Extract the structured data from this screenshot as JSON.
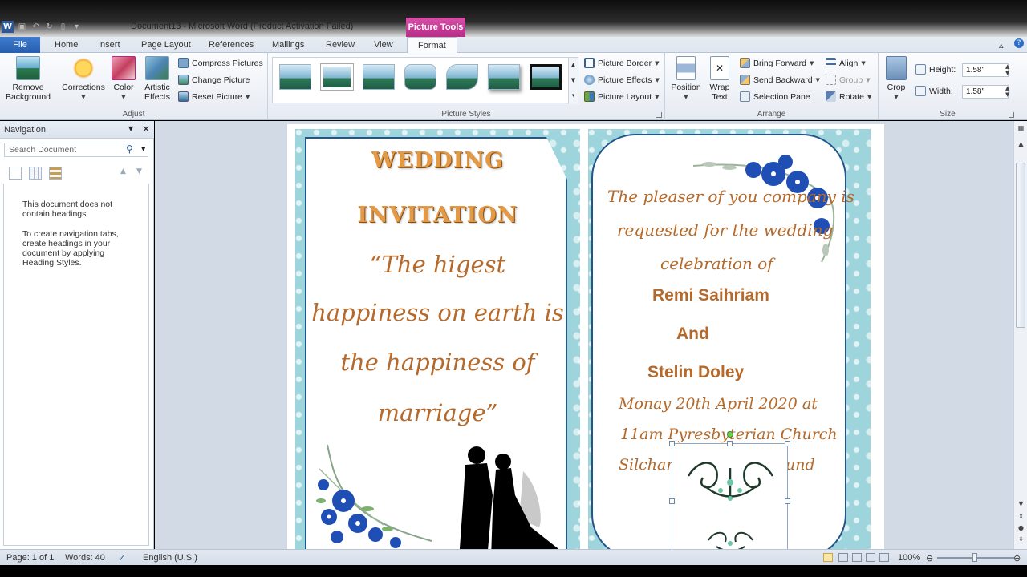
{
  "titlebar": {
    "document_title": "Document13 - Microsoft Word (Product Activation Failed)",
    "context_tab": "Picture Tools",
    "app_icon_letter": "W"
  },
  "tabs": {
    "file": "File",
    "home": "Home",
    "insert": "Insert",
    "page_layout": "Page Layout",
    "references": "References",
    "mailings": "Mailings",
    "review": "Review",
    "view": "View",
    "format": "Format"
  },
  "ribbon": {
    "adjust": {
      "label": "Adjust",
      "remove_background": "Remove Background",
      "corrections": "Corrections",
      "color": "Color",
      "artistic_effects": "Artistic Effects",
      "compress": "Compress Pictures",
      "change": "Change Picture",
      "reset": "Reset Picture"
    },
    "picture_styles": {
      "label": "Picture Styles",
      "border": "Picture Border",
      "effects": "Picture Effects",
      "layout": "Picture Layout"
    },
    "arrange": {
      "label": "Arrange",
      "position": "Position",
      "wrap_text": "Wrap Text",
      "bring_forward": "Bring Forward",
      "send_backward": "Send Backward",
      "selection_pane": "Selection Pane",
      "align": "Align",
      "group": "Group",
      "rotate": "Rotate"
    },
    "size": {
      "label": "Size",
      "crop": "Crop",
      "height_label": "Height:",
      "height_value": "1.58\"",
      "width_label": "Width:",
      "width_value": "1.58\""
    }
  },
  "navigation": {
    "title": "Navigation",
    "search_placeholder": "Search Document",
    "no_headings": "This document does not contain headings.",
    "help": "To create navigation tabs, create headings in your document by applying Heading Styles."
  },
  "card_left": {
    "title_1": "WEDDING",
    "title_2": "INVITATION",
    "quote_1": "“The higest",
    "quote_2": "happiness on earth is",
    "quote_3": "the happiness of",
    "quote_4": "marriage”"
  },
  "card_right": {
    "line_1": "The pleaser of you company is",
    "line_2": "requested for the wedding",
    "line_3": "celebration of",
    "name_1": "Remi Saihriam",
    "and": "And",
    "name_2": "Stelin Doley",
    "date_1": "Monay 20th April 2020 at",
    "date_2": "11am Pyresbyterian Church",
    "venue_left": "Silchar",
    "venue_right": "und"
  },
  "statusbar": {
    "page": "Page: 1 of 1",
    "words": "Words: 40",
    "language": "English (U.S.)",
    "zoom": "100%"
  },
  "colors": {
    "accent_context": "#c23d97",
    "file_tab": "#2e69bd",
    "card_border": "#22568a",
    "card_bg": "#9ed5dc",
    "text_gold": "#b5692a"
  }
}
